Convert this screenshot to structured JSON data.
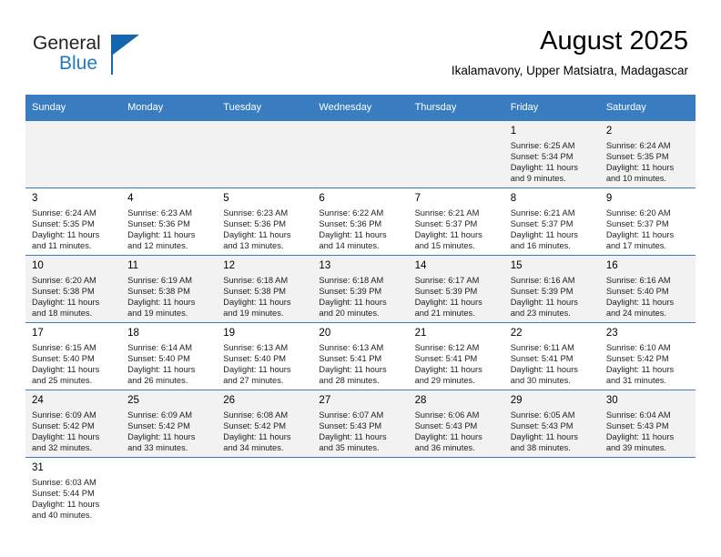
{
  "brand": {
    "name_top": "General",
    "name_bottom": "Blue",
    "accent_color": "#1566ae",
    "blue_text_color": "#1f7ac4"
  },
  "header": {
    "title": "August 2025",
    "location": "Ikalamavony, Upper Matsiatra, Madagascar"
  },
  "theme": {
    "header_row_bg": "#3a7cc0",
    "header_row_text": "#ffffff",
    "shaded_row_bg": "#f2f2f2",
    "plain_row_bg": "#ffffff",
    "grid_line": "#3a7cc0"
  },
  "weekdays": [
    "Sunday",
    "Monday",
    "Tuesday",
    "Wednesday",
    "Thursday",
    "Friday",
    "Saturday"
  ],
  "weeks": [
    [
      {
        "day": ""
      },
      {
        "day": ""
      },
      {
        "day": ""
      },
      {
        "day": ""
      },
      {
        "day": ""
      },
      {
        "day": "1",
        "sunrise": "Sunrise: 6:25 AM",
        "sunset": "Sunset: 5:34 PM",
        "daylight1": "Daylight: 11 hours",
        "daylight2": "and 9 minutes."
      },
      {
        "day": "2",
        "sunrise": "Sunrise: 6:24 AM",
        "sunset": "Sunset: 5:35 PM",
        "daylight1": "Daylight: 11 hours",
        "daylight2": "and 10 minutes."
      }
    ],
    [
      {
        "day": "3",
        "sunrise": "Sunrise: 6:24 AM",
        "sunset": "Sunset: 5:35 PM",
        "daylight1": "Daylight: 11 hours",
        "daylight2": "and 11 minutes."
      },
      {
        "day": "4",
        "sunrise": "Sunrise: 6:23 AM",
        "sunset": "Sunset: 5:36 PM",
        "daylight1": "Daylight: 11 hours",
        "daylight2": "and 12 minutes."
      },
      {
        "day": "5",
        "sunrise": "Sunrise: 6:23 AM",
        "sunset": "Sunset: 5:36 PM",
        "daylight1": "Daylight: 11 hours",
        "daylight2": "and 13 minutes."
      },
      {
        "day": "6",
        "sunrise": "Sunrise: 6:22 AM",
        "sunset": "Sunset: 5:36 PM",
        "daylight1": "Daylight: 11 hours",
        "daylight2": "and 14 minutes."
      },
      {
        "day": "7",
        "sunrise": "Sunrise: 6:21 AM",
        "sunset": "Sunset: 5:37 PM",
        "daylight1": "Daylight: 11 hours",
        "daylight2": "and 15 minutes."
      },
      {
        "day": "8",
        "sunrise": "Sunrise: 6:21 AM",
        "sunset": "Sunset: 5:37 PM",
        "daylight1": "Daylight: 11 hours",
        "daylight2": "and 16 minutes."
      },
      {
        "day": "9",
        "sunrise": "Sunrise: 6:20 AM",
        "sunset": "Sunset: 5:37 PM",
        "daylight1": "Daylight: 11 hours",
        "daylight2": "and 17 minutes."
      }
    ],
    [
      {
        "day": "10",
        "sunrise": "Sunrise: 6:20 AM",
        "sunset": "Sunset: 5:38 PM",
        "daylight1": "Daylight: 11 hours",
        "daylight2": "and 18 minutes."
      },
      {
        "day": "11",
        "sunrise": "Sunrise: 6:19 AM",
        "sunset": "Sunset: 5:38 PM",
        "daylight1": "Daylight: 11 hours",
        "daylight2": "and 19 minutes."
      },
      {
        "day": "12",
        "sunrise": "Sunrise: 6:18 AM",
        "sunset": "Sunset: 5:38 PM",
        "daylight1": "Daylight: 11 hours",
        "daylight2": "and 19 minutes."
      },
      {
        "day": "13",
        "sunrise": "Sunrise: 6:18 AM",
        "sunset": "Sunset: 5:39 PM",
        "daylight1": "Daylight: 11 hours",
        "daylight2": "and 20 minutes."
      },
      {
        "day": "14",
        "sunrise": "Sunrise: 6:17 AM",
        "sunset": "Sunset: 5:39 PM",
        "daylight1": "Daylight: 11 hours",
        "daylight2": "and 21 minutes."
      },
      {
        "day": "15",
        "sunrise": "Sunrise: 6:16 AM",
        "sunset": "Sunset: 5:39 PM",
        "daylight1": "Daylight: 11 hours",
        "daylight2": "and 23 minutes."
      },
      {
        "day": "16",
        "sunrise": "Sunrise: 6:16 AM",
        "sunset": "Sunset: 5:40 PM",
        "daylight1": "Daylight: 11 hours",
        "daylight2": "and 24 minutes."
      }
    ],
    [
      {
        "day": "17",
        "sunrise": "Sunrise: 6:15 AM",
        "sunset": "Sunset: 5:40 PM",
        "daylight1": "Daylight: 11 hours",
        "daylight2": "and 25 minutes."
      },
      {
        "day": "18",
        "sunrise": "Sunrise: 6:14 AM",
        "sunset": "Sunset: 5:40 PM",
        "daylight1": "Daylight: 11 hours",
        "daylight2": "and 26 minutes."
      },
      {
        "day": "19",
        "sunrise": "Sunrise: 6:13 AM",
        "sunset": "Sunset: 5:40 PM",
        "daylight1": "Daylight: 11 hours",
        "daylight2": "and 27 minutes."
      },
      {
        "day": "20",
        "sunrise": "Sunrise: 6:13 AM",
        "sunset": "Sunset: 5:41 PM",
        "daylight1": "Daylight: 11 hours",
        "daylight2": "and 28 minutes."
      },
      {
        "day": "21",
        "sunrise": "Sunrise: 6:12 AM",
        "sunset": "Sunset: 5:41 PM",
        "daylight1": "Daylight: 11 hours",
        "daylight2": "and 29 minutes."
      },
      {
        "day": "22",
        "sunrise": "Sunrise: 6:11 AM",
        "sunset": "Sunset: 5:41 PM",
        "daylight1": "Daylight: 11 hours",
        "daylight2": "and 30 minutes."
      },
      {
        "day": "23",
        "sunrise": "Sunrise: 6:10 AM",
        "sunset": "Sunset: 5:42 PM",
        "daylight1": "Daylight: 11 hours",
        "daylight2": "and 31 minutes."
      }
    ],
    [
      {
        "day": "24",
        "sunrise": "Sunrise: 6:09 AM",
        "sunset": "Sunset: 5:42 PM",
        "daylight1": "Daylight: 11 hours",
        "daylight2": "and 32 minutes."
      },
      {
        "day": "25",
        "sunrise": "Sunrise: 6:09 AM",
        "sunset": "Sunset: 5:42 PM",
        "daylight1": "Daylight: 11 hours",
        "daylight2": "and 33 minutes."
      },
      {
        "day": "26",
        "sunrise": "Sunrise: 6:08 AM",
        "sunset": "Sunset: 5:42 PM",
        "daylight1": "Daylight: 11 hours",
        "daylight2": "and 34 minutes."
      },
      {
        "day": "27",
        "sunrise": "Sunrise: 6:07 AM",
        "sunset": "Sunset: 5:43 PM",
        "daylight1": "Daylight: 11 hours",
        "daylight2": "and 35 minutes."
      },
      {
        "day": "28",
        "sunrise": "Sunrise: 6:06 AM",
        "sunset": "Sunset: 5:43 PM",
        "daylight1": "Daylight: 11 hours",
        "daylight2": "and 36 minutes."
      },
      {
        "day": "29",
        "sunrise": "Sunrise: 6:05 AM",
        "sunset": "Sunset: 5:43 PM",
        "daylight1": "Daylight: 11 hours",
        "daylight2": "and 38 minutes."
      },
      {
        "day": "30",
        "sunrise": "Sunrise: 6:04 AM",
        "sunset": "Sunset: 5:43 PM",
        "daylight1": "Daylight: 11 hours",
        "daylight2": "and 39 minutes."
      }
    ],
    [
      {
        "day": "31",
        "sunrise": "Sunrise: 6:03 AM",
        "sunset": "Sunset: 5:44 PM",
        "daylight1": "Daylight: 11 hours",
        "daylight2": "and 40 minutes."
      },
      {
        "day": ""
      },
      {
        "day": ""
      },
      {
        "day": ""
      },
      {
        "day": ""
      },
      {
        "day": ""
      },
      {
        "day": ""
      }
    ]
  ]
}
